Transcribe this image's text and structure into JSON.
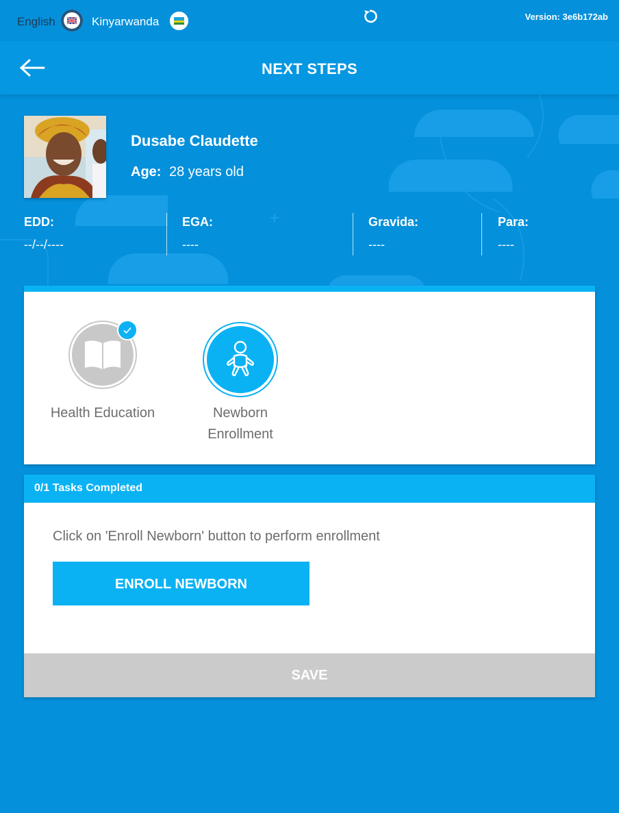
{
  "topbar": {
    "lang_en": "English",
    "lang_rw": "Kinyarwanda",
    "version": "Version: 3e6b172ab",
    "flag_en_icon": "uk-flag-icon",
    "flag_rw_icon": "rwanda-flag-icon",
    "refresh_icon": "refresh-icon"
  },
  "header": {
    "title": "NEXT STEPS",
    "back_icon": "arrow-left-icon"
  },
  "patient": {
    "name": "Dusabe Claudette",
    "age_label": "Age:",
    "age_value": "28 years old",
    "stats": [
      {
        "label": "EDD:",
        "value": "--/--/----"
      },
      {
        "label": "EGA:",
        "value": "----"
      },
      {
        "label": "Gravida:",
        "value": "----"
      },
      {
        "label": "Para:",
        "value": "----"
      }
    ]
  },
  "tasks": [
    {
      "label": "Health Education",
      "icon": "book-icon",
      "completed": true
    },
    {
      "label_line1": "Newborn",
      "label_line2": "Enrollment",
      "icon": "baby-icon",
      "active": true
    }
  ],
  "progress": {
    "text": "0/1 Tasks Completed",
    "instruction": "Click on 'Enroll Newborn' button to perform enrollment",
    "enroll_label": "ENROLL NEWBORN",
    "save_label": "SAVE"
  },
  "colors": {
    "background": "#0490db",
    "accent": "#0ab2f4",
    "save_disabled": "#cbcbcb",
    "muted_text": "#6c6c6c"
  }
}
